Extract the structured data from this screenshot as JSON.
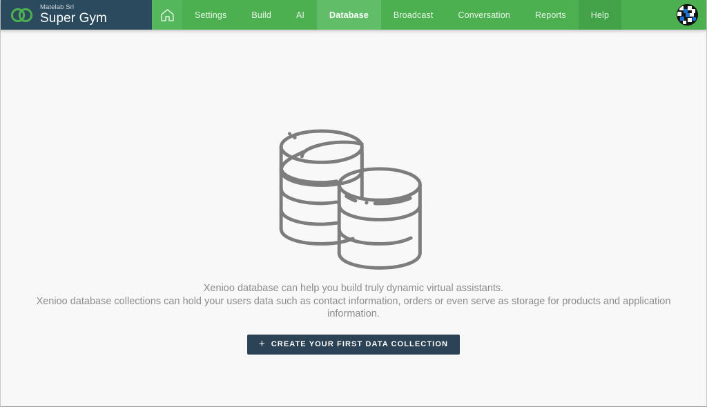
{
  "brand": {
    "company": "Matelab Srl",
    "product": "Super Gym",
    "logo_icon": "infinity-rings-icon",
    "background_color": "#2c4a5e",
    "logo_color": "#4caf50"
  },
  "header": {
    "background_color": "#4caf50",
    "active_color": "#62bd68",
    "home_icon": "home-icon",
    "home_label": "Home",
    "avatar_icon": "user-avatar-identicon",
    "nav_items": [
      {
        "label": "Settings",
        "state": "normal"
      },
      {
        "label": "Build",
        "state": "normal"
      },
      {
        "label": "AI",
        "state": "normal"
      },
      {
        "label": "Database",
        "state": "active"
      },
      {
        "label": "Broadcast",
        "state": "normal"
      },
      {
        "label": "Conversation",
        "state": "normal"
      },
      {
        "label": "Reports",
        "state": "normal"
      },
      {
        "label": "Help",
        "state": "dim"
      }
    ]
  },
  "main": {
    "illustration_icon": "database-stacks-icon",
    "illustration_color": "#7d7d7d",
    "description_line1": "Xenioo database can help you build truly dynamic virtual assistants.",
    "description_line2": "Xenioo database collections can hold your users data such as contact information, orders or even serve as storage for products and application information.",
    "text_color": "#8c8c8c",
    "cta": {
      "icon": "plus-icon",
      "plus": "+",
      "label": "Create your first data collection",
      "background_color": "#2c4356"
    }
  }
}
